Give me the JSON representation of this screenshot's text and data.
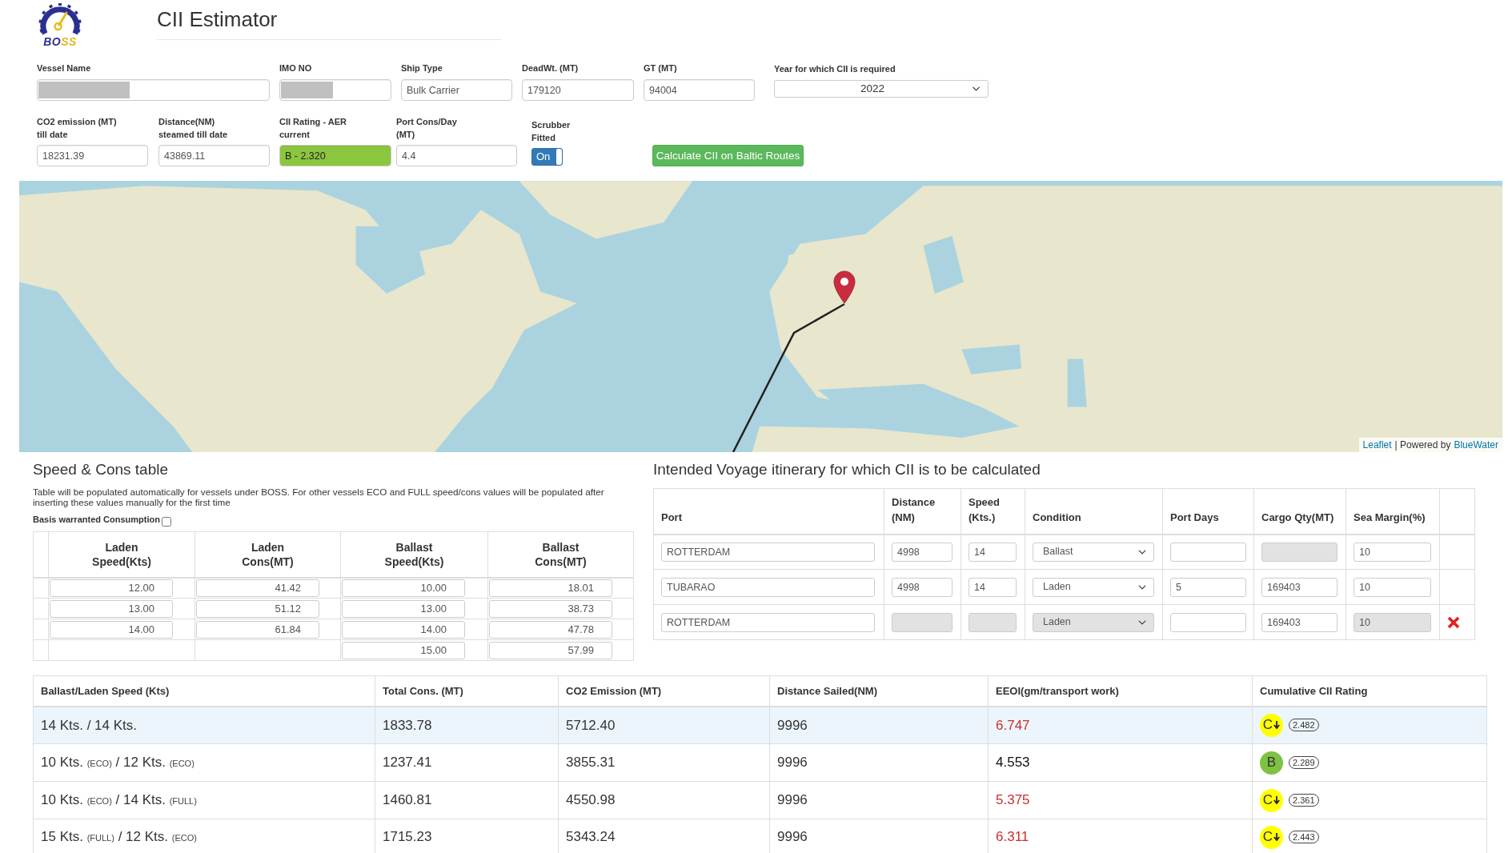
{
  "header": {
    "logo": [
      {
        "text": "BO",
        "color": "#2b2f8f"
      },
      {
        "text": "SS",
        "color": "#e0b820"
      }
    ],
    "title": "CII Estimator"
  },
  "form": {
    "particulars": [
      {
        "kind": "redacted",
        "label": "Vessel Name"
      },
      {
        "kind": "redacted",
        "label": "IMO NO"
      },
      {
        "kind": "text",
        "label": "Ship Type",
        "value": "Bulk Carrier"
      },
      {
        "kind": "text",
        "label": "DeadWt. (MT)",
        "value": "179120"
      },
      {
        "kind": "text",
        "label": "GT (MT)",
        "value": "94004"
      },
      {
        "kind": "select",
        "label": "Year for which CII is required",
        "value": "2022"
      }
    ],
    "status": [
      {
        "kind": "text",
        "label": "CO2 emission (MT)\ntill date",
        "value": "18231.39"
      },
      {
        "kind": "text",
        "label": "Distance(NM)\nsteamed till date",
        "value": "43869.11"
      },
      {
        "kind": "rating",
        "label": "CII Rating - AER\ncurrent",
        "value": "B - 2.320",
        "color": "#8cc63f"
      },
      {
        "kind": "text",
        "label": "Port Cons/Day\n(MT)",
        "value": "4.4"
      },
      {
        "kind": "toggle",
        "label": "Scrubber\nFitted",
        "text": "On",
        "on": true
      },
      {
        "kind": "button",
        "text": "Calculate CII on Baltic Routes"
      }
    ]
  },
  "map": {
    "attribution": [
      {
        "kind": "link",
        "text": "Leaflet"
      },
      {
        "kind": "text",
        "text": "| Powered by"
      },
      {
        "kind": "link",
        "text": "BlueWater"
      }
    ]
  },
  "speed_cons": {
    "title": "Speed & Cons table",
    "note": "Table will be populated automatically for vessels under BOSS. For other vessels ECO and FULL speed/cons values will be populated after inserting these values manually for the first time",
    "warranted": {
      "label": "Basis warranted Consumption",
      "checked": false
    },
    "columns": [
      "Laden\nSpeed(Kts)",
      "Laden\nCons(MT)",
      "Ballast\nSpeed(Kts)",
      "Ballast\nCons(MT)"
    ],
    "rows": [
      [
        "12.00",
        "41.42",
        "10.00",
        "18.01"
      ],
      [
        "13.00",
        "51.12",
        "13.00",
        "38.73"
      ],
      [
        "14.00",
        "61.84",
        "14.00",
        "47.78"
      ],
      [
        null,
        null,
        "15.00",
        "57.99"
      ]
    ]
  },
  "itinerary": {
    "title": "Intended Voyage itinerary for which CII is to be calculated",
    "columns": [
      "Port",
      "Distance\n(NM)",
      "Speed\n(Kts.)",
      "Condition",
      "Port Days",
      "Cargo Qty(MT)",
      "Sea Margin(%)"
    ],
    "rows": [
      {
        "deletable": false,
        "cells": [
          {
            "kind": "text",
            "value": "ROTTERDAM",
            "disabled": false
          },
          {
            "kind": "text",
            "value": "4998",
            "disabled": false
          },
          {
            "kind": "text",
            "value": "14",
            "disabled": false
          },
          {
            "kind": "select",
            "value": "Ballast",
            "disabled": false
          },
          {
            "kind": "text",
            "disabled": false
          },
          {
            "kind": "text",
            "disabled": true
          },
          {
            "kind": "text",
            "value": "10",
            "disabled": false
          }
        ]
      },
      {
        "deletable": false,
        "cells": [
          {
            "kind": "text",
            "value": "TUBARAO",
            "disabled": false
          },
          {
            "kind": "text",
            "value": "4998",
            "disabled": false
          },
          {
            "kind": "text",
            "value": "14",
            "disabled": false
          },
          {
            "kind": "select",
            "value": "Laden",
            "disabled": false
          },
          {
            "kind": "text",
            "value": "5",
            "disabled": false
          },
          {
            "kind": "text",
            "value": "169403",
            "disabled": false
          },
          {
            "kind": "text",
            "value": "10",
            "disabled": false
          }
        ]
      },
      {
        "deletable": true,
        "cells": [
          {
            "kind": "text",
            "value": "ROTTERDAM",
            "disabled": false
          },
          {
            "kind": "text",
            "disabled": true
          },
          {
            "kind": "text",
            "disabled": true
          },
          {
            "kind": "select",
            "value": "Laden",
            "disabled": true
          },
          {
            "kind": "text",
            "disabled": false
          },
          {
            "kind": "text",
            "value": "169403",
            "disabled": false
          },
          {
            "kind": "text",
            "value": "10",
            "disabled": true
          }
        ]
      }
    ]
  },
  "results": {
    "columns": [
      "Ballast/Laden Speed (Kts)",
      "Total Cons. (MT)",
      "CO2 Emission (MT)",
      "Distance Sailed(NM)",
      "EEOI(gm/transport work)",
      "Cumulative CII Rating"
    ],
    "rows": [
      {
        "selected": true,
        "speed": [
          {
            "kind": "main",
            "text": "14 Kts. / 14 Kts."
          }
        ],
        "total_cons": "1833.78",
        "co2": "5712.40",
        "distance": "9996",
        "eeoi": {
          "value": "6.747",
          "flagged": true
        },
        "rating": {
          "grade": "C",
          "declining": true,
          "color": "#ffff00",
          "value": "2.482"
        }
      },
      {
        "selected": false,
        "speed": [
          {
            "kind": "main",
            "text": "10 Kts."
          },
          {
            "kind": "tag",
            "text": "(ECO)"
          },
          {
            "kind": "main",
            "text": "/ 12 Kts."
          },
          {
            "kind": "tag",
            "text": "(ECO)"
          }
        ],
        "total_cons": "1237.41",
        "co2": "3855.31",
        "distance": "9996",
        "eeoi": {
          "value": "4.553",
          "flagged": false
        },
        "rating": {
          "grade": "B",
          "declining": false,
          "color": "#7dc242",
          "value": "2.289"
        }
      },
      {
        "selected": false,
        "speed": [
          {
            "kind": "main",
            "text": "10 Kts."
          },
          {
            "kind": "tag",
            "text": "(ECO)"
          },
          {
            "kind": "main",
            "text": "/ 14 Kts."
          },
          {
            "kind": "tag",
            "text": "(FULL)"
          }
        ],
        "total_cons": "1460.81",
        "co2": "4550.98",
        "distance": "9996",
        "eeoi": {
          "value": "5.375",
          "flagged": true
        },
        "rating": {
          "grade": "C",
          "declining": true,
          "color": "#ffff00",
          "value": "2.361"
        }
      },
      {
        "selected": false,
        "speed": [
          {
            "kind": "main",
            "text": "15 Kts."
          },
          {
            "kind": "tag",
            "text": "(FULL)"
          },
          {
            "kind": "main",
            "text": "/ 12 Kts."
          },
          {
            "kind": "tag",
            "text": "(ECO)"
          }
        ],
        "total_cons": "1715.23",
        "co2": "5343.24",
        "distance": "9996",
        "eeoi": {
          "value": "6.311",
          "flagged": true
        },
        "rating": {
          "grade": "C",
          "declining": true,
          "color": "#ffff00",
          "value": "2.443"
        }
      }
    ]
  }
}
